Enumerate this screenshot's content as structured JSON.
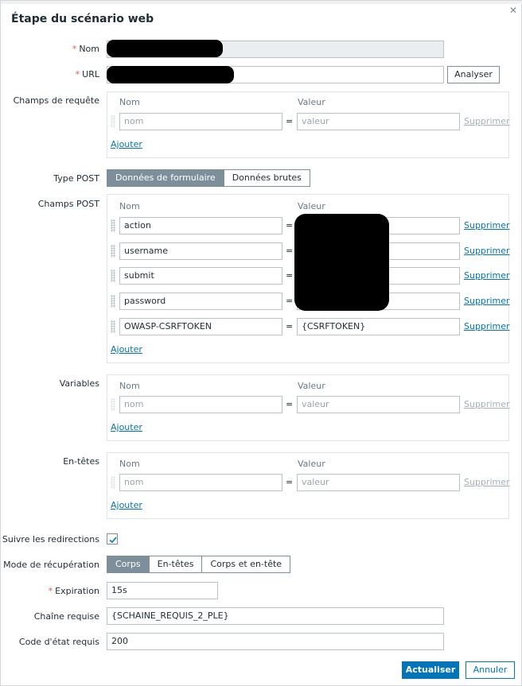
{
  "dialog": {
    "title": "Étape du scénario web"
  },
  "form": {
    "name": {
      "label": "Nom",
      "required_mark": "*"
    },
    "url": {
      "label": "URL",
      "required_mark": "*",
      "parse_button": "Analyser"
    },
    "query_fields": {
      "label": "Champs de requête",
      "col_name": "Nom",
      "col_value": "Valeur",
      "rows": [
        {
          "name_placeholder": "nom",
          "value_placeholder": "valeur",
          "remove": "Supprimer"
        }
      ],
      "add": "Ajouter"
    },
    "post_type": {
      "label": "Type POST",
      "options": [
        "Données de formulaire",
        "Données brutes"
      ],
      "selected": "Données de formulaire"
    },
    "post_fields": {
      "label": "Champs POST",
      "col_name": "Nom",
      "col_value": "Valeur",
      "rows": [
        {
          "name": "action",
          "value": "",
          "remove": "Supprimer"
        },
        {
          "name": "username",
          "value": "",
          "remove": "Supprimer"
        },
        {
          "name": "submit",
          "value": "",
          "remove": "Supprimer"
        },
        {
          "name": "password",
          "value": "",
          "remove": "Supprimer"
        },
        {
          "name": "OWASP-CSRFTOKEN",
          "value": "{CSRFTOKEN}",
          "remove": "Supprimer"
        }
      ],
      "add": "Ajouter"
    },
    "variables": {
      "label": "Variables",
      "col_name": "Nom",
      "col_value": "Valeur",
      "rows": [
        {
          "name_placeholder": "nom",
          "value_placeholder": "valeur",
          "remove": "Supprimer"
        }
      ],
      "add": "Ajouter"
    },
    "headers": {
      "label": "En-têtes",
      "col_name": "Nom",
      "col_value": "Valeur",
      "rows": [
        {
          "name_placeholder": "nom",
          "value_placeholder": "valeur",
          "remove": "Supprimer"
        }
      ],
      "add": "Ajouter"
    },
    "follow_redirects": {
      "label": "Suivre les redirections",
      "checked": true
    },
    "retrieve_mode": {
      "label": "Mode de récupération",
      "options": [
        "Corps",
        "En-têtes",
        "Corps et en-tête"
      ],
      "selected": "Corps"
    },
    "timeout": {
      "label": "Expiration",
      "required_mark": "*",
      "value": "15s"
    },
    "required_string": {
      "label": "Chaîne requise",
      "value": "{SCHAINE_REQUIS_2_PLE}"
    },
    "status_codes": {
      "label": "Code d'état requis",
      "value": "200"
    }
  },
  "footer": {
    "update": "Actualiser",
    "cancel": "Annuler"
  },
  "eq_sign": "="
}
